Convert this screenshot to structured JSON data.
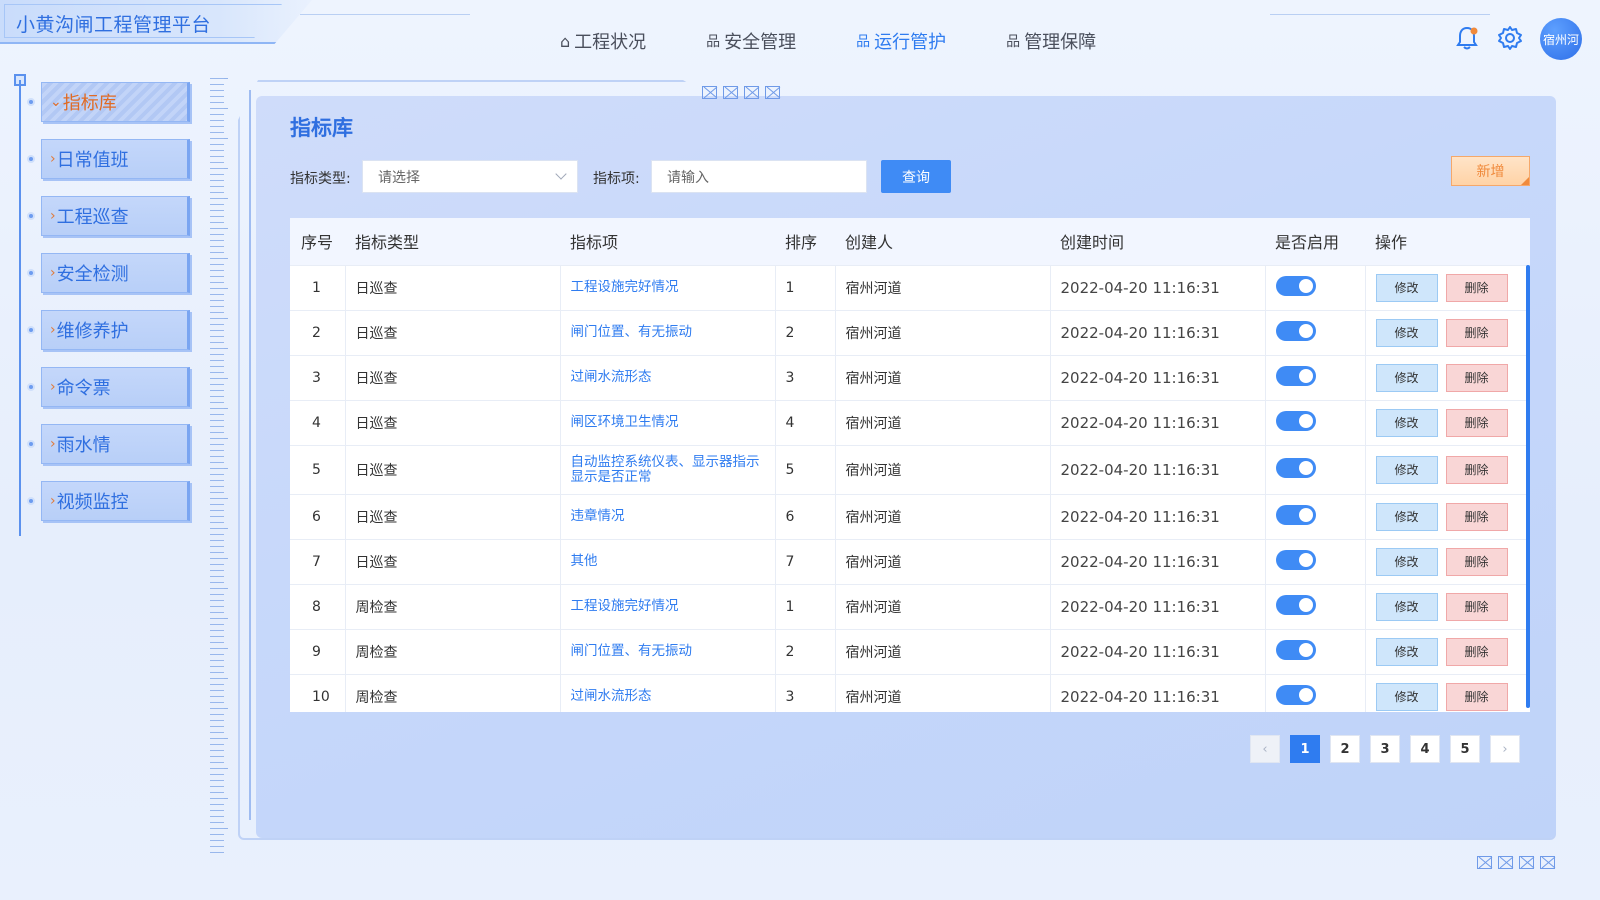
{
  "app": {
    "title": "小黄沟闸工程管理平台",
    "user": "宿州河"
  },
  "nav": [
    {
      "label": "工程状况",
      "icon": "home-icon",
      "active": false
    },
    {
      "label": "安全管理",
      "icon": "sitemap-icon",
      "active": false
    },
    {
      "label": "运行管护",
      "icon": "sitemap-icon",
      "active": true
    },
    {
      "label": "管理保障",
      "icon": "sitemap-icon",
      "active": false
    }
  ],
  "sidebar": {
    "items": [
      {
        "label": "指标库",
        "active": true
      },
      {
        "label": "日常值班",
        "active": false
      },
      {
        "label": "工程巡查",
        "active": false
      },
      {
        "label": "安全检测",
        "active": false
      },
      {
        "label": "维修养护",
        "active": false
      },
      {
        "label": "命令票",
        "active": false
      },
      {
        "label": "雨水情",
        "active": false
      },
      {
        "label": "视频监控",
        "active": false
      }
    ]
  },
  "page": {
    "title": "指标库"
  },
  "filters": {
    "type_label": "指标类型:",
    "type_placeholder": "请选择",
    "item_label": "指标项:",
    "item_placeholder": "请输入",
    "query_label": "查询",
    "add_label": "新增"
  },
  "table": {
    "columns": [
      "序号",
      "指标类型",
      "指标项",
      "排序",
      "创建人",
      "创建时间",
      "是否启用",
      "操作"
    ],
    "edit_label": "修改",
    "delete_label": "删除",
    "rows": [
      {
        "no": "1",
        "type": "日巡查",
        "item": "工程设施完好情况",
        "order": "1",
        "creator": "宿州河道",
        "time": "2022-04-20 11:16:31",
        "enabled": true
      },
      {
        "no": "2",
        "type": "日巡查",
        "item": "闸门位置、有无振动",
        "order": "2",
        "creator": "宿州河道",
        "time": "2022-04-20 11:16:31",
        "enabled": true
      },
      {
        "no": "3",
        "type": "日巡查",
        "item": "过闸水流形态",
        "order": "3",
        "creator": "宿州河道",
        "time": "2022-04-20 11:16:31",
        "enabled": true
      },
      {
        "no": "4",
        "type": "日巡查",
        "item": "闸区环境卫生情况",
        "order": "4",
        "creator": "宿州河道",
        "time": "2022-04-20 11:16:31",
        "enabled": true
      },
      {
        "no": "5",
        "type": "日巡查",
        "item": "自动监控系统仪表、显示器指示显示是否正常",
        "order": "5",
        "creator": "宿州河道",
        "time": "2022-04-20 11:16:31",
        "enabled": true
      },
      {
        "no": "6",
        "type": "日巡查",
        "item": "违章情况",
        "order": "6",
        "creator": "宿州河道",
        "time": "2022-04-20 11:16:31",
        "enabled": true
      },
      {
        "no": "7",
        "type": "日巡查",
        "item": "其他",
        "order": "7",
        "creator": "宿州河道",
        "time": "2022-04-20 11:16:31",
        "enabled": true
      },
      {
        "no": "8",
        "type": "周检查",
        "item": "工程设施完好情况",
        "order": "1",
        "creator": "宿州河道",
        "time": "2022-04-20 11:16:31",
        "enabled": true
      },
      {
        "no": "9",
        "type": "周检查",
        "item": "闸门位置、有无振动",
        "order": "2",
        "creator": "宿州河道",
        "time": "2022-04-20 11:16:31",
        "enabled": true
      },
      {
        "no": "10",
        "type": "周检查",
        "item": "过闸水流形态",
        "order": "3",
        "creator": "宿州河道",
        "time": "2022-04-20 11:16:31",
        "enabled": true
      }
    ]
  },
  "pagination": {
    "pages": [
      "1",
      "2",
      "3",
      "4",
      "5"
    ],
    "current": "1",
    "prev": "‹",
    "next": "›"
  },
  "colors": {
    "accent": "#2f7cf0",
    "active_side": "#e06b25",
    "add": "#f08a3c"
  }
}
